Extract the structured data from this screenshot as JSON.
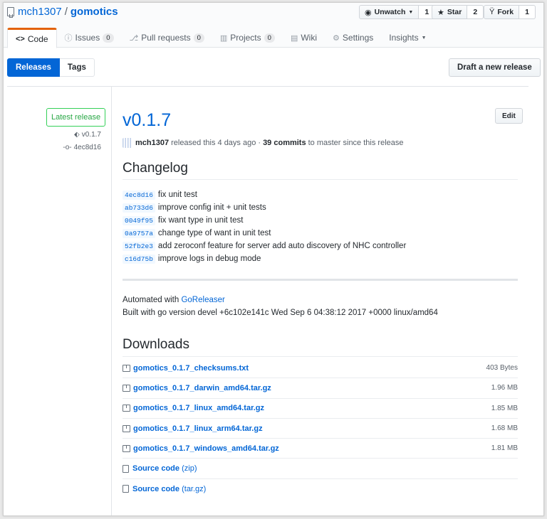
{
  "repo": {
    "owner": "mch1307",
    "separator": "/",
    "name": "gomotics"
  },
  "actions": {
    "watch": {
      "label": "Unwatch",
      "count": "1"
    },
    "star": {
      "label": "Star",
      "count": "2"
    },
    "fork": {
      "label": "Fork",
      "count": "1"
    }
  },
  "tabs": [
    {
      "label": "Code",
      "icon": "code-icon"
    },
    {
      "label": "Issues",
      "count": "0",
      "icon": "issue-icon"
    },
    {
      "label": "Pull requests",
      "count": "0",
      "icon": "pull-request-icon"
    },
    {
      "label": "Projects",
      "count": "0",
      "icon": "project-icon"
    },
    {
      "label": "Wiki",
      "icon": "book-icon"
    },
    {
      "label": "Settings",
      "icon": "gear-icon"
    },
    {
      "label": "Insights",
      "icon": "graph-icon"
    }
  ],
  "subnav": {
    "releases": "Releases",
    "tags": "Tags"
  },
  "new_release_button": "Draft a new release",
  "release": {
    "latest_label": "Latest release",
    "tag": "v0.1.7",
    "commit": "4ec8d16",
    "title": "v0.1.7",
    "edit_label": "Edit",
    "author": "mch1307",
    "authorship_text": "released this 4 days ago ·",
    "commits_count": "39 commits",
    "commits_suffix": "to master since this release"
  },
  "changelog": {
    "heading": "Changelog",
    "items": [
      {
        "sha": "4ec8d16",
        "message": "fix unit test"
      },
      {
        "sha": "ab733d6",
        "message": "improve config init + unit tests"
      },
      {
        "sha": "0049f95",
        "message": "fix want type in unit test"
      },
      {
        "sha": "0a9757a",
        "message": "change type of want in unit test"
      },
      {
        "sha": "52fb2e3",
        "message": "add zeroconf feature for server add auto discovery of NHC controller"
      },
      {
        "sha": "c16d75b",
        "message": "improve logs in debug mode"
      }
    ]
  },
  "automated": {
    "prefix": "Automated with",
    "link": "GoReleaser"
  },
  "built_with": "Built with go version devel +6c102e141c Wed Sep 6 04:38:12 2017 +0000 linux/amd64",
  "downloads": {
    "heading": "Downloads",
    "assets": [
      {
        "name": "gomotics_0.1.7_checksums.txt",
        "size": "403 Bytes"
      },
      {
        "name": "gomotics_0.1.7_darwin_amd64.tar.gz",
        "size": "1.96 MB"
      },
      {
        "name": "gomotics_0.1.7_linux_amd64.tar.gz",
        "size": "1.85 MB"
      },
      {
        "name": "gomotics_0.1.7_linux_arm64.tar.gz",
        "size": "1.68 MB"
      },
      {
        "name": "gomotics_0.1.7_windows_amd64.tar.gz",
        "size": "1.81 MB"
      }
    ],
    "source": [
      {
        "label": "Source code",
        "format": "(zip)"
      },
      {
        "label": "Source code",
        "format": "(tar.gz)"
      }
    ]
  }
}
